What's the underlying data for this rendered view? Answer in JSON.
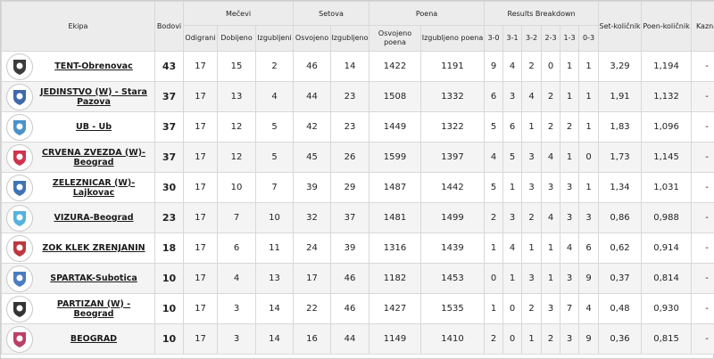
{
  "headers": {
    "ekipa": "Ekipa",
    "bodovi": "Bodovi",
    "mecevi": "Mečevi",
    "setova": "Setova",
    "poena": "Poena",
    "results": "Results Breakdown",
    "set_kolicnik": "Set-količnik",
    "poen_kolicnik": "Poen-količnik",
    "kazna": "Kazna",
    "odigrani": "Odigrani",
    "dobijeno": "Dobijeno",
    "izgubljeni": "Izgubljeni",
    "osvojeno": "Osvojeno",
    "izgubljeno": "Izgubljeno",
    "osvojeno_poena": "Osvojeno poena",
    "izgubljeno_poena": "Izgubljeno poena",
    "r30": "3-0",
    "r31": "3-1",
    "r32": "3-2",
    "r23": "2-3",
    "r13": "1-3",
    "r03": "0-3"
  },
  "rows": [
    {
      "team": "TENT-Obrenovac",
      "pts": "43",
      "odigrani": "17",
      "dobijeno": "15",
      "izgubljeni": "2",
      "sw": "46",
      "sl": "14",
      "pw": "1422",
      "pl": "1191",
      "r30": "9",
      "r31": "4",
      "r32": "2",
      "r23": "0",
      "r13": "1",
      "r03": "1",
      "setk": "3,29",
      "poenk": "1,194",
      "kazna": "-",
      "logo_color": "#1a1a1a"
    },
    {
      "team": "JEDINSTVO (W) - Stara Pazova",
      "pts": "37",
      "odigrani": "17",
      "dobijeno": "13",
      "izgubljeni": "4",
      "sw": "44",
      "sl": "23",
      "pw": "1508",
      "pl": "1332",
      "r30": "6",
      "r31": "3",
      "r32": "4",
      "r23": "2",
      "r13": "1",
      "r03": "1",
      "setk": "1,91",
      "poenk": "1,132",
      "kazna": "-",
      "logo_color": "#1f4e9c"
    },
    {
      "team": "UB - Ub",
      "pts": "37",
      "odigrani": "17",
      "dobijeno": "12",
      "izgubljeni": "5",
      "sw": "42",
      "sl": "23",
      "pw": "1449",
      "pl": "1322",
      "r30": "5",
      "r31": "6",
      "r32": "1",
      "r23": "2",
      "r13": "2",
      "r03": "1",
      "setk": "1,83",
      "poenk": "1,096",
      "kazna": "-",
      "logo_color": "#2a7fc1"
    },
    {
      "team": "CRVENA ZVEZDA (W)-Beograd",
      "pts": "37",
      "odigrani": "17",
      "dobijeno": "12",
      "izgubljeni": "5",
      "sw": "45",
      "sl": "26",
      "pw": "1599",
      "pl": "1397",
      "r30": "4",
      "r31": "5",
      "r32": "3",
      "r23": "4",
      "r13": "1",
      "r03": "0",
      "setk": "1,73",
      "poenk": "1,145",
      "kazna": "-",
      "logo_color": "#c8102e"
    },
    {
      "team": "ZELEZNICAR (W)-Lajkovac",
      "pts": "30",
      "odigrani": "17",
      "dobijeno": "10",
      "izgubljeni": "7",
      "sw": "39",
      "sl": "29",
      "pw": "1487",
      "pl": "1442",
      "r30": "5",
      "r31": "1",
      "r32": "3",
      "r23": "3",
      "r13": "3",
      "r03": "1",
      "setk": "1,34",
      "poenk": "1,031",
      "kazna": "-",
      "logo_color": "#1f5aa6"
    },
    {
      "team": "VIZURA-Beograd",
      "pts": "23",
      "odigrani": "17",
      "dobijeno": "7",
      "izgubljeni": "10",
      "sw": "32",
      "sl": "37",
      "pw": "1481",
      "pl": "1499",
      "r30": "2",
      "r31": "3",
      "r32": "2",
      "r23": "4",
      "r13": "3",
      "r03": "3",
      "setk": "0,86",
      "poenk": "0,988",
      "kazna": "-",
      "logo_color": "#3aa3d8"
    },
    {
      "team": "ZOK KLEK ZRENJANIN",
      "pts": "18",
      "odigrani": "17",
      "dobijeno": "6",
      "izgubljeni": "11",
      "sw": "24",
      "sl": "39",
      "pw": "1316",
      "pl": "1439",
      "r30": "1",
      "r31": "4",
      "r32": "1",
      "r23": "1",
      "r13": "4",
      "r03": "6",
      "setk": "0,62",
      "poenk": "0,914",
      "kazna": "-",
      "logo_color": "#b3141c"
    },
    {
      "team": "SPARTAK-Subotica",
      "pts": "10",
      "odigrani": "17",
      "dobijeno": "4",
      "izgubljeni": "13",
      "sw": "17",
      "sl": "46",
      "pw": "1182",
      "pl": "1453",
      "r30": "0",
      "r31": "1",
      "r32": "3",
      "r23": "1",
      "r13": "3",
      "r03": "9",
      "setk": "0,37",
      "poenk": "0,814",
      "kazna": "-",
      "logo_color": "#2b64b5"
    },
    {
      "team": "PARTIZAN (W) - Beograd",
      "pts": "10",
      "odigrani": "17",
      "dobijeno": "3",
      "izgubljeni": "14",
      "sw": "22",
      "sl": "46",
      "pw": "1427",
      "pl": "1535",
      "r30": "1",
      "r31": "0",
      "r32": "2",
      "r23": "3",
      "r13": "7",
      "r03": "4",
      "setk": "0,48",
      "poenk": "0,930",
      "kazna": "-",
      "logo_color": "#111111"
    },
    {
      "team": "BEOGRAD",
      "pts": "10",
      "odigrani": "17",
      "dobijeno": "3",
      "izgubljeni": "14",
      "sw": "16",
      "sl": "44",
      "pw": "1149",
      "pl": "1410",
      "r30": "2",
      "r31": "0",
      "r32": "1",
      "r23": "2",
      "r13": "3",
      "r03": "9",
      "setk": "0,36",
      "poenk": "0,815",
      "kazna": "-",
      "logo_color": "#b01e4a"
    }
  ]
}
